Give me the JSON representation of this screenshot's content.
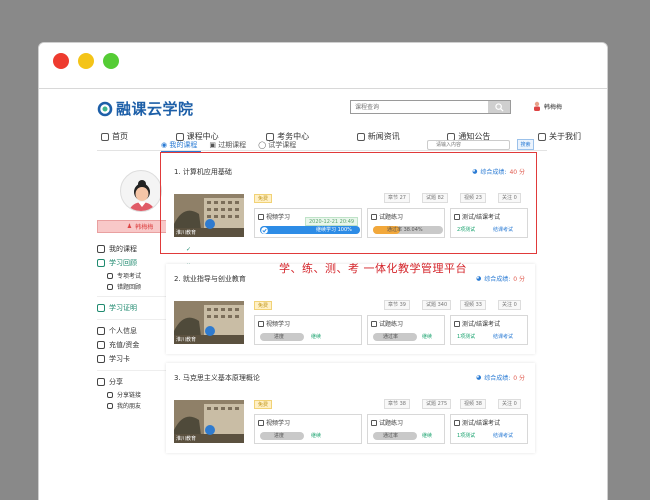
{
  "site": {
    "logo_text": "融课云学院",
    "search_placeholder": "课程查询",
    "user_name": "韩梅梅"
  },
  "nav": [
    {
      "label": "首页",
      "icon": "home-icon"
    },
    {
      "label": "课程中心",
      "icon": "course-icon"
    },
    {
      "label": "考务中心",
      "icon": "exam-icon"
    },
    {
      "label": "新闻资讯",
      "icon": "news-icon"
    },
    {
      "label": "通知公告",
      "icon": "notice-icon"
    },
    {
      "label": "关于我们",
      "icon": "about-icon"
    }
  ],
  "sidebar": {
    "user_badge": "韩梅梅",
    "items": [
      {
        "label": "我的课程",
        "check": "✓"
      },
      {
        "label": "学习回顾",
        "chev": "⌄"
      },
      {
        "label": "专项考试"
      },
      {
        "label": "错题回顾"
      },
      {
        "label": "学习证明"
      },
      {
        "label": "个人信息"
      },
      {
        "label": "充值/资金"
      },
      {
        "label": "学习卡"
      },
      {
        "label": "分享",
        "chev": "⌄"
      },
      {
        "label": "分享链接"
      },
      {
        "label": "我的朋友"
      }
    ]
  },
  "tabs": [
    {
      "label": "我的课程"
    },
    {
      "label": "过期课程"
    },
    {
      "label": "试学课程"
    }
  ],
  "filter": {
    "placeholder": "请输入内容",
    "button": "搜索"
  },
  "slogan": "学、练、测、考 一体化教学管理平台",
  "colors": {
    "accent": "#2a7bd4",
    "green": "#1f8a6f",
    "red": "#e03a3a"
  },
  "cards": [
    {
      "title": "1. 计算机应用基础",
      "score_label": "综合成绩:",
      "score_value": "40 分",
      "free_tag": "免费",
      "thumb_label": "淮川教育",
      "meta": [
        "章节 27",
        "试题 82",
        "视频 23",
        "关注 0"
      ],
      "video_label": "视频学习",
      "video_date": "2020-12-21 20:49",
      "video_progress_text": "继续学习 100%",
      "video_progress": 1.0,
      "practice_label": "试题练习",
      "practice_progress_text": "通过率 38.04%",
      "practice_progress": 0.3804,
      "test_label": "测试/结课考试",
      "test_count": "2项测试",
      "test_action": "结课考试"
    },
    {
      "title": "2. 就业指导与创业教育",
      "score_label": "综合成绩:",
      "score_value": "0 分",
      "free_tag": "免费",
      "thumb_label": "淮川教育",
      "meta": [
        "章节 39",
        "试题 340",
        "视频 33",
        "关注 0"
      ],
      "video_label": "视频学习",
      "video_progress_text": "进度",
      "video_action": "继续",
      "video_progress": 0.0,
      "practice_label": "试题练习",
      "practice_progress_text": "通过率",
      "practice_action": "继续",
      "practice_progress": 0.0,
      "test_label": "测试/结课考试",
      "test_count": "1项测试",
      "test_action": "结课考试"
    },
    {
      "title": "3. 马克思主义基本原理概论",
      "score_label": "综合成绩:",
      "score_value": "0 分",
      "free_tag": "免费",
      "thumb_label": "淮川教育",
      "meta": [
        "章节 38",
        "试题 275",
        "视频 38",
        "关注 0"
      ],
      "video_label": "视频学习",
      "video_progress_text": "进度",
      "video_action": "继续",
      "video_progress": 0.0,
      "practice_label": "试题练习",
      "practice_progress_text": "通过率",
      "practice_action": "继续",
      "practice_progress": 0.0,
      "test_label": "测试/结课考试",
      "test_count": "1项测试",
      "test_action": "结课考试"
    }
  ]
}
